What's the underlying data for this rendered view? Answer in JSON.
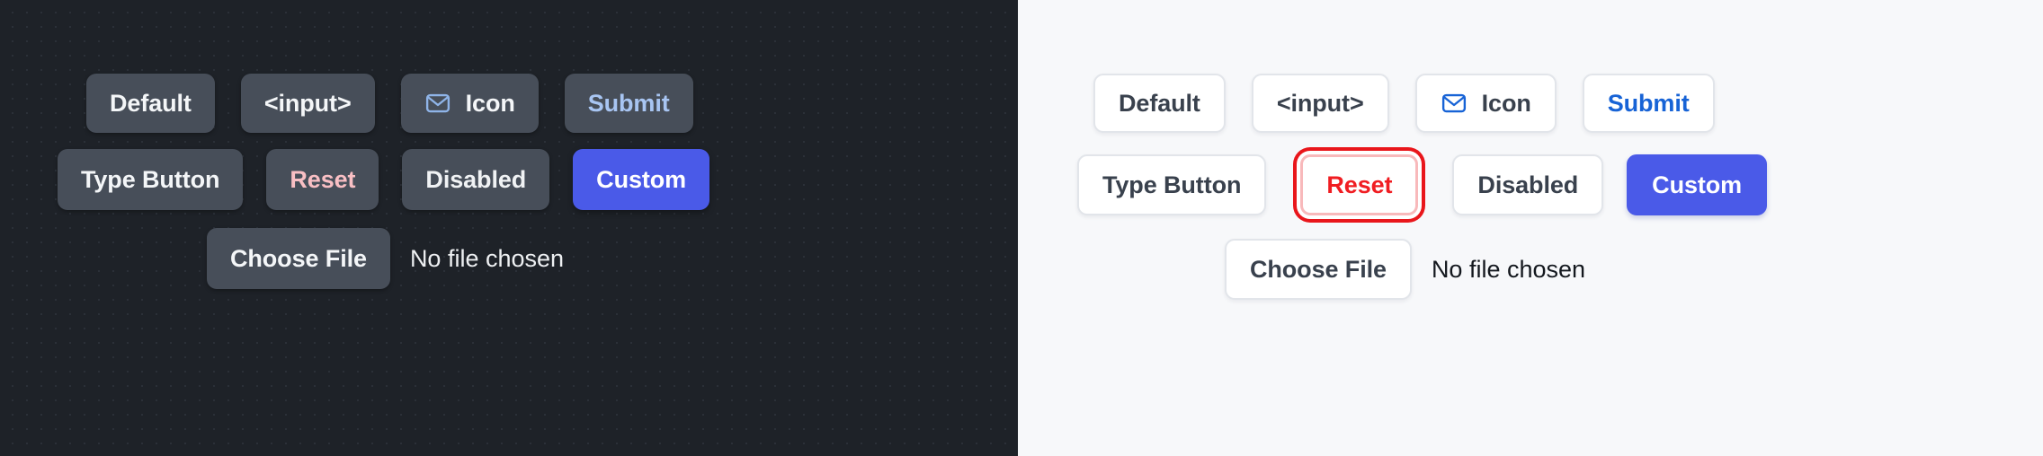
{
  "theme": {
    "dark_bg": "#1e2228",
    "dark_button_bg": "#474e59",
    "light_bg": "#f7f8fa",
    "light_button_bg": "#ffffff",
    "light_button_border": "#e2e5ea",
    "accent_custom": "#4a5ae8",
    "accent_submit_light": "#1763d6",
    "accent_submit_dark": "#a8c5f2",
    "danger_light": "#f01d22",
    "danger_dark": "#f9bfc4",
    "focus_ring": "#e9161b"
  },
  "panels": {
    "dark": {
      "rows": [
        [
          {
            "name": "default-button",
            "label": "Default",
            "icon": null
          },
          {
            "name": "input-button",
            "label": "<input>",
            "icon": null
          },
          {
            "name": "icon-button",
            "label": "Icon",
            "icon": "envelope-icon"
          },
          {
            "name": "submit-button",
            "label": "Submit",
            "icon": null
          }
        ],
        [
          {
            "name": "type-button",
            "label": "Type Button",
            "icon": null
          },
          {
            "name": "reset-button",
            "label": "Reset",
            "icon": null
          },
          {
            "name": "disabled-button",
            "label": "Disabled",
            "icon": null
          },
          {
            "name": "custom-button",
            "label": "Custom",
            "icon": null
          }
        ]
      ],
      "file_input": {
        "button_label": "Choose File",
        "status_text": "No file chosen"
      }
    },
    "light": {
      "rows": [
        [
          {
            "name": "default-button",
            "label": "Default",
            "icon": null
          },
          {
            "name": "input-button",
            "label": "<input>",
            "icon": null
          },
          {
            "name": "icon-button",
            "label": "Icon",
            "icon": "envelope-icon"
          },
          {
            "name": "submit-button",
            "label": "Submit",
            "icon": null
          }
        ],
        [
          {
            "name": "type-button",
            "label": "Type Button",
            "icon": null
          },
          {
            "name": "reset-button",
            "label": "Reset",
            "icon": null
          },
          {
            "name": "disabled-button",
            "label": "Disabled",
            "icon": null
          },
          {
            "name": "custom-button",
            "label": "Custom",
            "icon": null
          }
        ]
      ],
      "file_input": {
        "button_label": "Choose File",
        "status_text": "No file chosen"
      }
    }
  }
}
